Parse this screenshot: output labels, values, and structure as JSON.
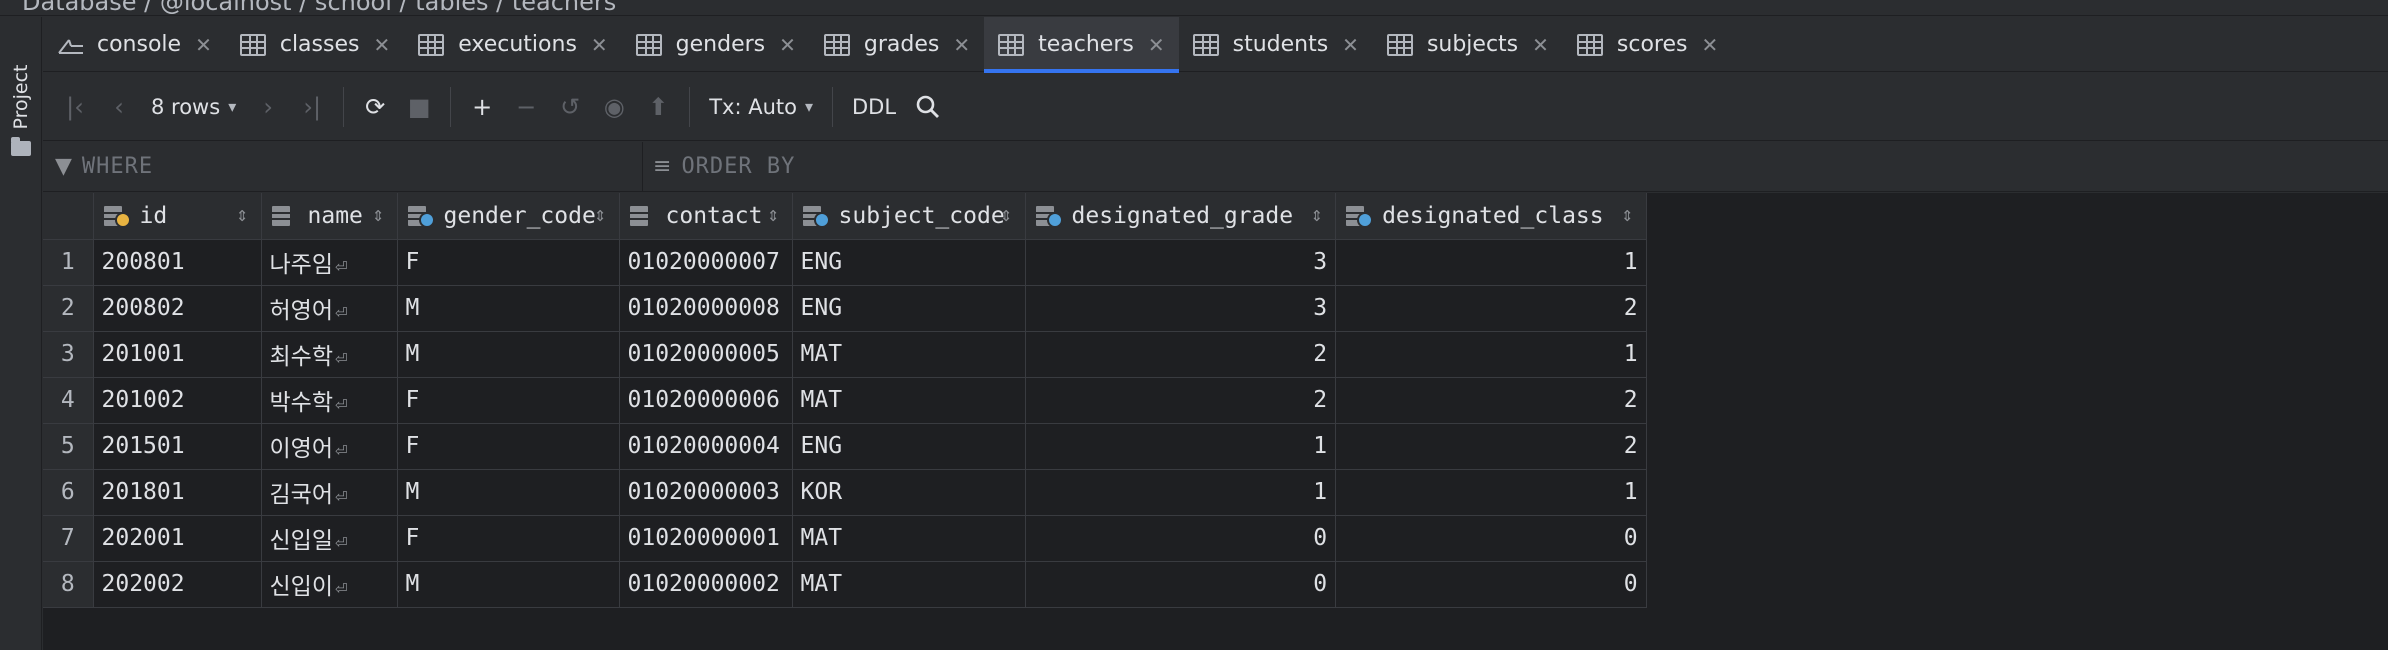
{
  "breadcrumb": "Database / @localhost / school / tables / teachers",
  "left_panel": {
    "project_label": "Project"
  },
  "tabs": [
    {
      "label": "console",
      "icon": "console-icon",
      "active": false
    },
    {
      "label": "classes",
      "icon": "table-icon",
      "active": false
    },
    {
      "label": "executions",
      "icon": "table-icon",
      "active": false
    },
    {
      "label": "genders",
      "icon": "table-icon",
      "active": false
    },
    {
      "label": "grades",
      "icon": "table-icon",
      "active": false
    },
    {
      "label": "teachers",
      "icon": "table-icon",
      "active": true
    },
    {
      "label": "students",
      "icon": "table-icon",
      "active": false
    },
    {
      "label": "subjects",
      "icon": "table-icon",
      "active": false
    },
    {
      "label": "scores",
      "icon": "table-icon",
      "active": false
    }
  ],
  "toolbar": {
    "rows_label": "8 rows",
    "tx_label": "Tx: Auto",
    "ddl_label": "DDL"
  },
  "filters": {
    "where_placeholder": "WHERE",
    "order_placeholder": "ORDER BY"
  },
  "table": {
    "columns": [
      {
        "name": "id",
        "icon": "primary-key-column-icon"
      },
      {
        "name": "name",
        "icon": "column-icon"
      },
      {
        "name": "gender_code",
        "icon": "foreign-key-column-icon"
      },
      {
        "name": "contact",
        "icon": "column-icon"
      },
      {
        "name": "subject_code",
        "icon": "foreign-key-column-icon"
      },
      {
        "name": "designated_grade",
        "icon": "foreign-key-column-icon"
      },
      {
        "name": "designated_class",
        "icon": "foreign-key-column-icon"
      }
    ],
    "rows": [
      {
        "n": "1",
        "id": "200801",
        "name": "나주임",
        "gender_code": "F",
        "contact": "01020000007",
        "subject_code": "ENG",
        "designated_grade": "3",
        "designated_class": "1"
      },
      {
        "n": "2",
        "id": "200802",
        "name": "허영어",
        "gender_code": "M",
        "contact": "01020000008",
        "subject_code": "ENG",
        "designated_grade": "3",
        "designated_class": "2"
      },
      {
        "n": "3",
        "id": "201001",
        "name": "최수학",
        "gender_code": "M",
        "contact": "01020000005",
        "subject_code": "MAT",
        "designated_grade": "2",
        "designated_class": "1"
      },
      {
        "n": "4",
        "id": "201002",
        "name": "박수학",
        "gender_code": "F",
        "contact": "01020000006",
        "subject_code": "MAT",
        "designated_grade": "2",
        "designated_class": "2"
      },
      {
        "n": "5",
        "id": "201501",
        "name": "이영어",
        "gender_code": "F",
        "contact": "01020000004",
        "subject_code": "ENG",
        "designated_grade": "1",
        "designated_class": "2"
      },
      {
        "n": "6",
        "id": "201801",
        "name": "김국어",
        "gender_code": "M",
        "contact": "01020000003",
        "subject_code": "KOR",
        "designated_grade": "1",
        "designated_class": "1"
      },
      {
        "n": "7",
        "id": "202001",
        "name": "신입일",
        "gender_code": "F",
        "contact": "01020000001",
        "subject_code": "MAT",
        "designated_grade": "0",
        "designated_class": "0"
      },
      {
        "n": "8",
        "id": "202002",
        "name": "신입이",
        "gender_code": "M",
        "contact": "01020000002",
        "subject_code": "MAT",
        "designated_grade": "0",
        "designated_class": "0"
      }
    ]
  },
  "colors": {
    "accent": "#3574f0",
    "background": "#1e1f22",
    "panel": "#2b2d30",
    "primary_key": "#e8b341",
    "foreign_key": "#4f9fd9"
  }
}
